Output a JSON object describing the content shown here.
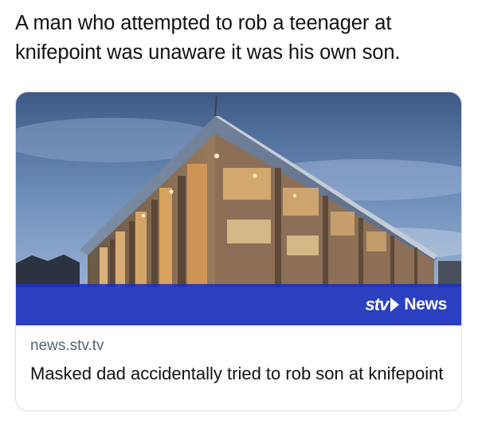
{
  "tweet": {
    "text": "A man who attempted to rob a teenager at knifepoint was unaware it was his own son."
  },
  "card": {
    "image_alt": "Modern court building at dusk",
    "brand_logo_text": "stv",
    "brand_news_text": "News",
    "domain": "news.stv.tv",
    "title": "Masked dad accidentally tried to rob son at knifepoint"
  },
  "colors": {
    "brand_blue": "#1a30be",
    "text_primary": "#0f1419",
    "text_secondary": "#536471",
    "border": "#d9dee2"
  }
}
